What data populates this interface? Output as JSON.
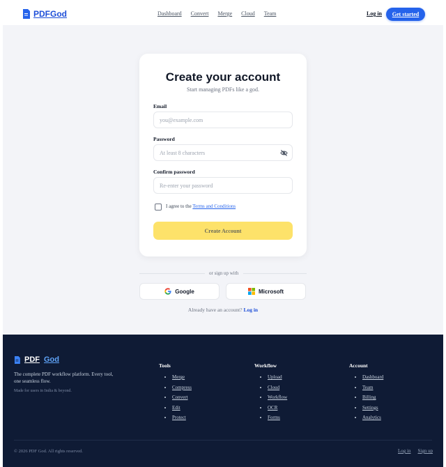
{
  "header": {
    "brand": "PDFGod",
    "nav": [
      "Dashboard",
      "Convert",
      "Merge",
      "Cloud",
      "Team"
    ],
    "login": "Log in",
    "get_started": "Get started"
  },
  "signup": {
    "title": "Create your account",
    "subtitle": "Start managing PDFs like a god.",
    "email_label": "Email",
    "email_placeholder": "you@example.com",
    "password_label": "Password",
    "password_placeholder": "At least 8 characters",
    "confirm_label": "Confirm password",
    "confirm_placeholder": "Re-enter your password",
    "agree_prefix": "I agree to the",
    "terms_link": "Terms and Conditions",
    "create_button": "Create Account",
    "divider": "or sign up with",
    "google": "Google",
    "microsoft": "Microsoft",
    "already_text": "Already have an account?",
    "already_link": "Log in"
  },
  "footer": {
    "brand_pdf": "PDF",
    "brand_god": "God",
    "description": "The complete PDF workflow platform. Every tool, one seamless flow.",
    "made_for": "Made for users in India & beyond.",
    "columns": [
      {
        "title": "Tools",
        "items": [
          "Merge",
          "Compress",
          "Convert",
          "Edit",
          "Protect"
        ]
      },
      {
        "title": "Workflow",
        "items": [
          "Upload",
          "Cloud",
          "Workflow",
          "OCR",
          "Forms"
        ]
      },
      {
        "title": "Account",
        "items": [
          "Dashboard",
          "Team",
          "Billing",
          "Settings",
          "Analytics"
        ]
      }
    ],
    "copyright": "© 2026 PDF God. All rights reserved.",
    "bottom_links": [
      "Log in",
      "Sign up"
    ]
  },
  "colors": {
    "accent": "#2563eb",
    "create_button": "#fde26a",
    "footer_bg": "#0f1b35",
    "main_bg": "#f3f4f8"
  },
  "icons": [
    "document-icon",
    "eye-off-icon",
    "google-icon",
    "microsoft-icon"
  ]
}
